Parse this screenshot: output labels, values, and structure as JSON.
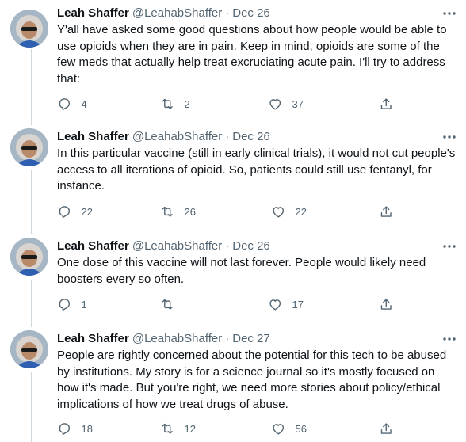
{
  "tweets": [
    {
      "name": "Leah Shaffer",
      "handle": "@LeahabShaffer",
      "separator": "·",
      "date": "Dec 26",
      "text": "Y'all have asked some good questions about how people would be able to use opioids when they are in pain. Keep in mind, opioids are some of the few meds that actually help treat excruciating acute pain. I'll try to address that:",
      "replies": "4",
      "retweets": "2",
      "likes": "37"
    },
    {
      "name": "Leah Shaffer",
      "handle": "@LeahabShaffer",
      "separator": "·",
      "date": "Dec 26",
      "text": "In this particular vaccine (still in early clinical trials), it would not cut people's access to all iterations of opioid. So, patients could still use fentanyl, for instance.",
      "replies": "22",
      "retweets": "26",
      "likes": "22"
    },
    {
      "name": "Leah Shaffer",
      "handle": "@LeahabShaffer",
      "separator": "·",
      "date": "Dec 26",
      "text": "One dose of this vaccine will not last forever. People would likely need boosters every so often.",
      "replies": "1",
      "retweets": "",
      "likes": "17"
    },
    {
      "name": "Leah Shaffer",
      "handle": "@LeahabShaffer",
      "separator": "·",
      "date": "Dec 27",
      "text": "People are rightly concerned about the potential for this tech to be abused by institutions. My story is for a science journal so it's mostly focused on how it's made. But you're right, we need more stories about policy/ethical implications of how we treat drugs of abuse.",
      "replies": "18",
      "retweets": "12",
      "likes": "56"
    }
  ],
  "icons": {
    "reply": "reply-icon",
    "retweet": "retweet-icon",
    "like": "like-icon",
    "share": "share-icon",
    "more": "more-icon"
  },
  "colors": {
    "text": "#0f1419",
    "secondary": "#536471",
    "thread_line": "#cfd9de"
  }
}
